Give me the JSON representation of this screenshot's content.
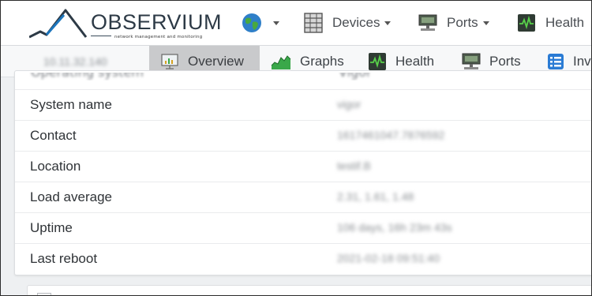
{
  "app": {
    "logo_text": "OBSERVIUM",
    "logo_tagline": "network management and monitoring"
  },
  "navbar": {
    "globe_icon": "globe-icon",
    "devices_label": "Devices",
    "ports_label": "Ports",
    "health_label": "Health"
  },
  "subnav": {
    "device_ip": "10.11.32.140",
    "tabs": [
      {
        "label": "Overview",
        "icon": "overview-chart-icon",
        "active": true
      },
      {
        "label": "Graphs",
        "icon": "area-graph-icon",
        "active": false
      },
      {
        "label": "Health",
        "icon": "heartbeat-icon",
        "active": false
      },
      {
        "label": "Ports",
        "icon": "network-port-icon",
        "active": false
      },
      {
        "label": "Inv",
        "icon": "inventory-list-icon",
        "active": false
      }
    ]
  },
  "overview": {
    "cut_row": {
      "label": "Operating system",
      "value": "Vigor"
    },
    "rows": [
      {
        "label": "System name",
        "value": "vigor"
      },
      {
        "label": "Contact",
        "value": "1617461047.7876592"
      },
      {
        "label": "Location",
        "value": "testif.B"
      },
      {
        "label": "Load average",
        "value": "2.31, 1.61, 1.48"
      },
      {
        "label": "Uptime",
        "value": "106 days, 16h 23m 43s"
      },
      {
        "label": "Last reboot",
        "value": "2021-02-18 09:51:40"
      }
    ]
  },
  "colors": {
    "brand_dark": "#2d3a46",
    "brand_blue": "#1c75bc",
    "active_tab_bg": "#c9cacc",
    "health_icon_bg": "#2f3b33",
    "health_icon_line": "#58d04a",
    "graph_green": "#3aa84a",
    "inv_blue": "#2a7bd4"
  }
}
